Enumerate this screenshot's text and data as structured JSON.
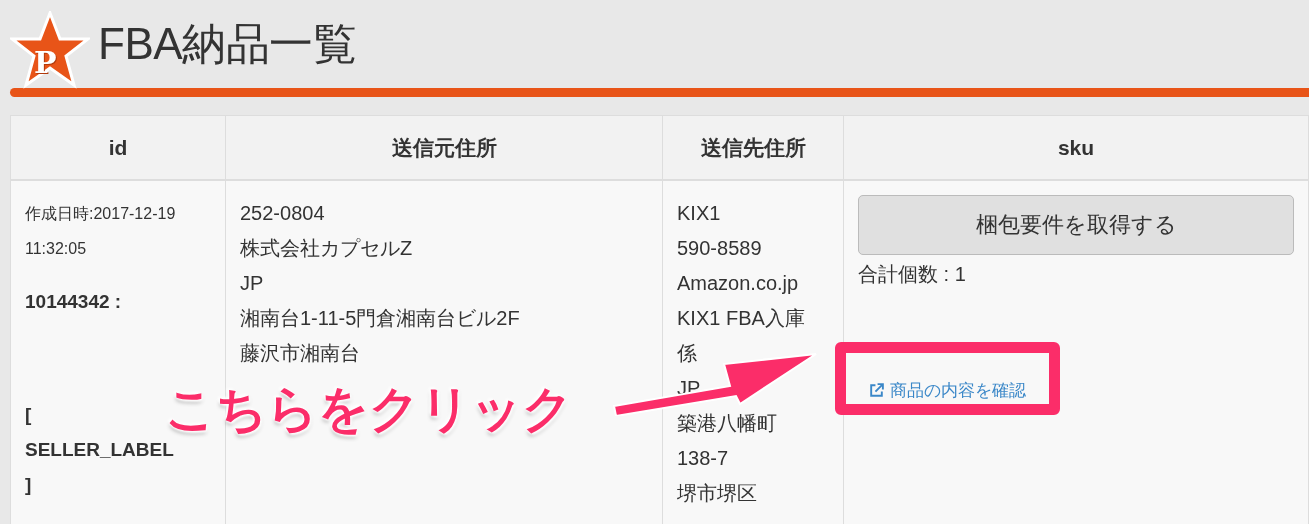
{
  "header": {
    "logo": "P",
    "title": "FBA納品一覧"
  },
  "table": {
    "columns": [
      "id",
      "送信元住所",
      "送信先住所",
      "sku"
    ],
    "rows": [
      {
        "created": "作成日時:2017-12-19 11:32:05",
        "id": "10144342 :",
        "label": "[ SELLER_LABEL ]",
        "from_address": [
          "252-0804",
          "株式会社カプセルZ",
          "JP",
          "湘南台1-11-5門倉湘南台ビル2F",
          "藤沢市湘南台"
        ],
        "to_address": [
          "KIX1",
          "590-8589",
          "Amazon.co.jp",
          "KIX1 FBA入庫係",
          "JP",
          "築港八幡町",
          "138-7",
          "堺市堺区"
        ],
        "button": "梱包要件を取得する",
        "total": "合計個数 : 1",
        "link": "商品の内容を確認"
      }
    ]
  },
  "annotation": {
    "callout": "こちらをクリック"
  }
}
